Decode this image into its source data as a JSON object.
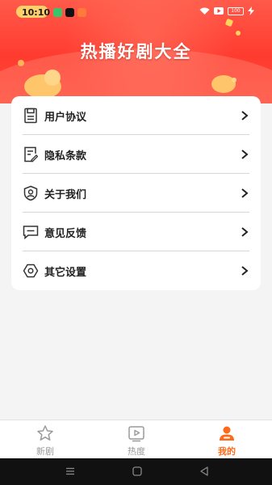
{
  "status_bar": {
    "time": "10:10",
    "battery": "100"
  },
  "hero": {
    "title": "热播好剧大全"
  },
  "menu": {
    "items": [
      {
        "label": "用户协议",
        "icon": "document-icon"
      },
      {
        "label": "隐私条款",
        "icon": "edit-document-icon"
      },
      {
        "label": "关于我们",
        "icon": "shield-user-icon"
      },
      {
        "label": "意见反馈",
        "icon": "message-icon"
      },
      {
        "label": "其它设置",
        "icon": "settings-icon"
      }
    ]
  },
  "tabbar": {
    "tabs": [
      {
        "label": "新剧",
        "icon": "star-icon",
        "active": false
      },
      {
        "label": "热度",
        "icon": "video-icon",
        "active": false
      },
      {
        "label": "我的",
        "icon": "profile-icon",
        "active": true
      }
    ]
  },
  "colors": {
    "hero_red": "#ff3b2f",
    "active_tab": "#ff6a1a",
    "background": "#f4f4f4"
  }
}
